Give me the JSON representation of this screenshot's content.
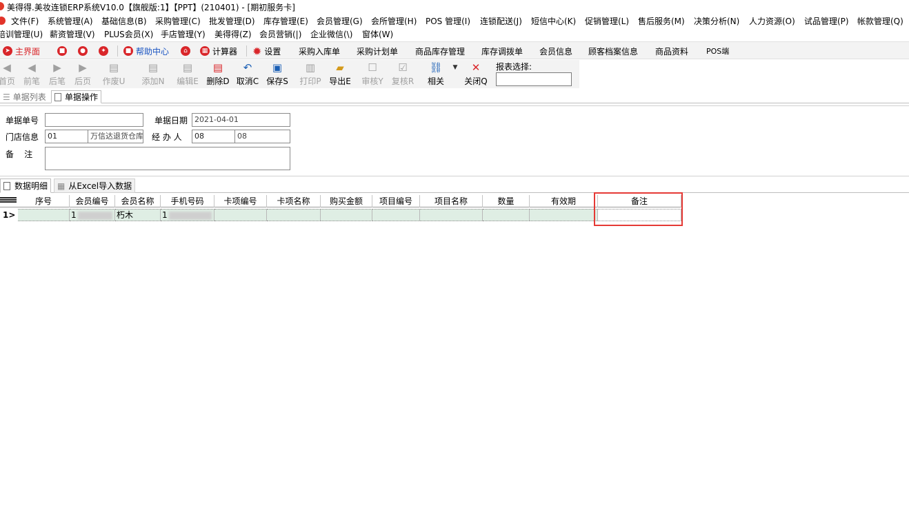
{
  "window": {
    "title": "美得得.美妆连锁ERP系统V10.0【旗舰版:1】【PPT】(210401) - [期初服务卡]"
  },
  "menu": {
    "row1": [
      "文件(F)",
      "系统管理(A)",
      "基础信息(B)",
      "采购管理(C)",
      "批发管理(D)",
      "库存管理(E)",
      "会员管理(G)",
      "会所管理(H)",
      "POS 管理(I)",
      "连锁配送(J)",
      "短信中心(K)",
      "促销管理(L)",
      "售后服务(M)",
      "决策分析(N)",
      "人力资源(O)",
      "试品管理(P)",
      "帐款管理(Q)"
    ],
    "row2": [
      "培训管理(U)",
      "薪资管理(V)",
      "PLUS会员(X)",
      "手店管理(Y)",
      "美得得(Z)",
      "会员营销(|)",
      "企业微信(\\)",
      "窗体(W)"
    ]
  },
  "quicknav": {
    "main": "主界面",
    "help": "帮助中心",
    "calculator": "计算器",
    "settings": "设置",
    "purchase_in": "采购入库单",
    "purchase_plan": "采购计划单",
    "stock_mgmt": "商品库存管理",
    "stock_transfer": "库存调拨单",
    "member_info": "会员信息",
    "customer_archive": "顾客档案信息",
    "product_data": "商品资料",
    "pos": "POS端"
  },
  "toolbar": {
    "first": "首页",
    "prev": "前笔",
    "next": "后笔",
    "last": "后页",
    "void": "作废U",
    "add": "添加N",
    "edit": "编辑E",
    "delete": "删除D",
    "cancel": "取消C",
    "save": "保存S",
    "print": "打印P",
    "export": "导出E",
    "audit": "审核Y",
    "reaudit": "复核R",
    "related": "相关",
    "close": "关闭Q",
    "report_select_label": "报表选择:"
  },
  "tabs": {
    "list": "单据列表",
    "operation": "单据操作"
  },
  "form": {
    "doc_no_label": "单据单号",
    "doc_no": "",
    "doc_date_label": "单据日期",
    "doc_date": "2021-04-01",
    "store_label": "门店信息",
    "store_code": "01",
    "store_name": "万信达退货仓库",
    "handler_label": "经 办 人",
    "handler_code": "08",
    "handler_name": "08",
    "remark_label": "备    注",
    "remark": ""
  },
  "subtabs": {
    "detail": "数据明细",
    "import": "从Excel导入数据"
  },
  "grid": {
    "columns": [
      "序号",
      "会员编号",
      "会员名称",
      "手机号码",
      "卡项编号",
      "卡项名称",
      "购买金额",
      "项目编号",
      "项目名称",
      "数量",
      "有效期",
      "备注"
    ],
    "rows": [
      {
        "marker": "1>",
        "seq": "",
        "member_no": "1",
        "member_name": "朽木",
        "phone": "1",
        "card_no": "",
        "card_name": "",
        "amount": "",
        "item_no": "",
        "item_name": "",
        "qty": "",
        "expiry": "",
        "remark": ""
      }
    ]
  }
}
